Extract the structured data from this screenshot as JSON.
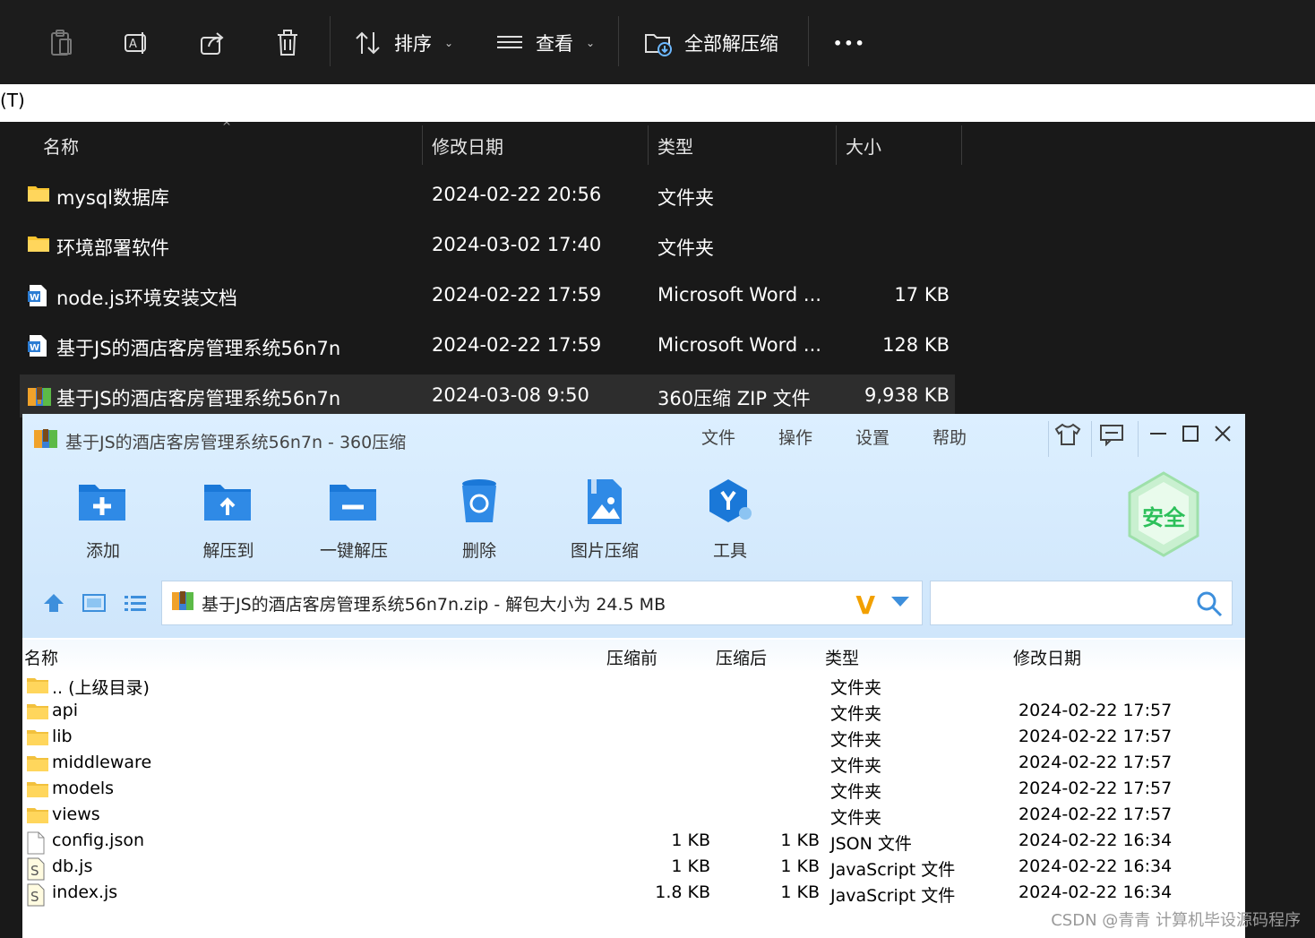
{
  "explorer": {
    "toolbar": {
      "sort_label": "排序",
      "view_label": "查看",
      "extract_all_label": "全部解压缩",
      "more_label": "•••"
    },
    "address_text": "(T)",
    "columns": {
      "name": "名称",
      "date": "修改日期",
      "type": "类型",
      "size": "大小"
    },
    "rows": [
      {
        "icon": "folder-icon",
        "name": "mysql数据库",
        "date": "2024-02-22 20:56",
        "type": "文件夹",
        "size": ""
      },
      {
        "icon": "folder-icon",
        "name": "环境部署软件",
        "date": "2024-03-02 17:40",
        "type": "文件夹",
        "size": ""
      },
      {
        "icon": "word-doc-icon",
        "name": "node.js环境安装文档",
        "date": "2024-02-22 17:59",
        "type": "Microsoft Word ...",
        "size": "17 KB"
      },
      {
        "icon": "word-doc-icon",
        "name": "基于JS的酒店客房管理系统56n7n",
        "date": "2024-02-22 17:59",
        "type": "Microsoft Word ...",
        "size": "128 KB"
      },
      {
        "icon": "zip-archive-icon",
        "name": "基于JS的酒店客房管理系统56n7n",
        "date": "2024-03-08 9:50",
        "type": "360压缩 ZIP 文件",
        "size": "9,938 KB"
      }
    ]
  },
  "zip_window": {
    "title": "基于JS的酒店客房管理系统56n7n - 360压缩",
    "menu": [
      "文件",
      "操作",
      "设置",
      "帮助"
    ],
    "tools": [
      "添加",
      "解压到",
      "一键解压",
      "删除",
      "图片压缩",
      "工具"
    ],
    "badge_text": "安全",
    "path_text": "基于JS的酒店客房管理系统56n7n.zip - 解包大小为 24.5 MB",
    "columns": {
      "name": "名称",
      "before": "压缩前",
      "after": "压缩后",
      "type": "类型",
      "date": "修改日期"
    },
    "rows": [
      {
        "icon": "folder-icon",
        "name": ".. (上级目录)",
        "before": "",
        "after": "",
        "type": "文件夹",
        "date": ""
      },
      {
        "icon": "folder-icon",
        "name": "api",
        "before": "",
        "after": "",
        "type": "文件夹",
        "date": "2024-02-22 17:57"
      },
      {
        "icon": "folder-icon",
        "name": "lib",
        "before": "",
        "after": "",
        "type": "文件夹",
        "date": "2024-02-22 17:57"
      },
      {
        "icon": "folder-icon",
        "name": "middleware",
        "before": "",
        "after": "",
        "type": "文件夹",
        "date": "2024-02-22 17:57"
      },
      {
        "icon": "folder-icon",
        "name": "models",
        "before": "",
        "after": "",
        "type": "文件夹",
        "date": "2024-02-22 17:57"
      },
      {
        "icon": "folder-icon",
        "name": "views",
        "before": "",
        "after": "",
        "type": "文件夹",
        "date": "2024-02-22 17:57"
      },
      {
        "icon": "file-icon",
        "name": "config.json",
        "before": "1 KB",
        "after": "1 KB",
        "type": "JSON 文件",
        "date": "2024-02-22 16:34"
      },
      {
        "icon": "js-file-icon",
        "name": "db.js",
        "before": "1 KB",
        "after": "1 KB",
        "type": "JavaScript 文件",
        "date": "2024-02-22 16:34"
      },
      {
        "icon": "js-file-icon",
        "name": "index.js",
        "before": "1.8 KB",
        "after": "1 KB",
        "type": "JavaScript 文件",
        "date": "2024-02-22 16:34"
      }
    ]
  },
  "watermark": "CSDN @青青  计算机毕设源码程序",
  "colors": {
    "dark_bg": "#191919",
    "zip_header": "#d6ebfd",
    "folder": "#f8c430",
    "accent_blue": "#3d8fdc"
  }
}
